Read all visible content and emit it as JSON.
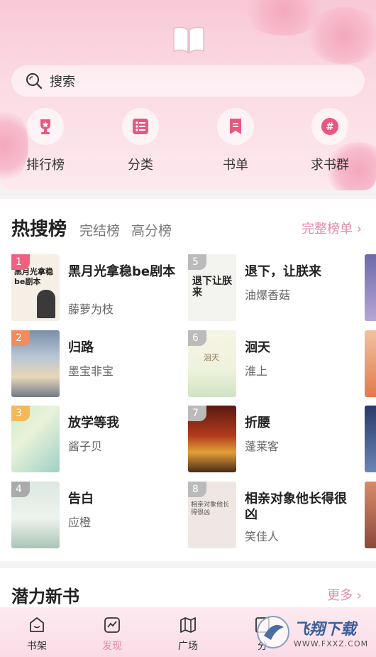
{
  "search": {
    "placeholder": "搜索"
  },
  "quick_links": [
    {
      "label": "排行榜",
      "icon": "trophy-icon"
    },
    {
      "label": "分类",
      "icon": "list-icon"
    },
    {
      "label": "书单",
      "icon": "bookmark-icon"
    },
    {
      "label": "求书群",
      "icon": "hashtag-icon"
    }
  ],
  "hot": {
    "title": "热搜榜",
    "tabs": [
      "完结榜",
      "高分榜"
    ],
    "more": "完整榜单 ›",
    "books": [
      {
        "rank": "1",
        "title": "黑月光拿稳be剧本",
        "author": "藤萝为枝"
      },
      {
        "rank": "2",
        "title": "归路",
        "author": "墨宝非宝"
      },
      {
        "rank": "3",
        "title": "放学等我",
        "author": "酱子贝"
      },
      {
        "rank": "4",
        "title": "告白",
        "author": "应橙"
      },
      {
        "rank": "5",
        "title": "退下，让朕来",
        "author": "油爆香菇"
      },
      {
        "rank": "6",
        "title": "洄天",
        "author": "淮上"
      },
      {
        "rank": "7",
        "title": "折腰",
        "author": "蓬莱客"
      },
      {
        "rank": "8",
        "title": "相亲对象他长得很凶",
        "author": "笑佳人"
      }
    ],
    "cover_text": {
      "b1": "黑月光拿稳be剧本",
      "b5": "退下让朕来",
      "b6": "洄天",
      "b8": "相亲对象他长得很凶"
    }
  },
  "new_books": {
    "title": "潜力新书",
    "more": "更多 ›"
  },
  "nav": [
    {
      "label": "书架",
      "icon": "shelf-icon"
    },
    {
      "label": "发现",
      "icon": "discover-icon",
      "active": true
    },
    {
      "label": "广场",
      "icon": "map-icon"
    },
    {
      "label": "分",
      "icon": "category-icon"
    }
  ],
  "watermark": {
    "text": "飞翔下载",
    "url": "WWW.FXXZ.COM"
  },
  "colors": {
    "accent": "#e38aa7",
    "header_pink": "#f8c9d6"
  }
}
